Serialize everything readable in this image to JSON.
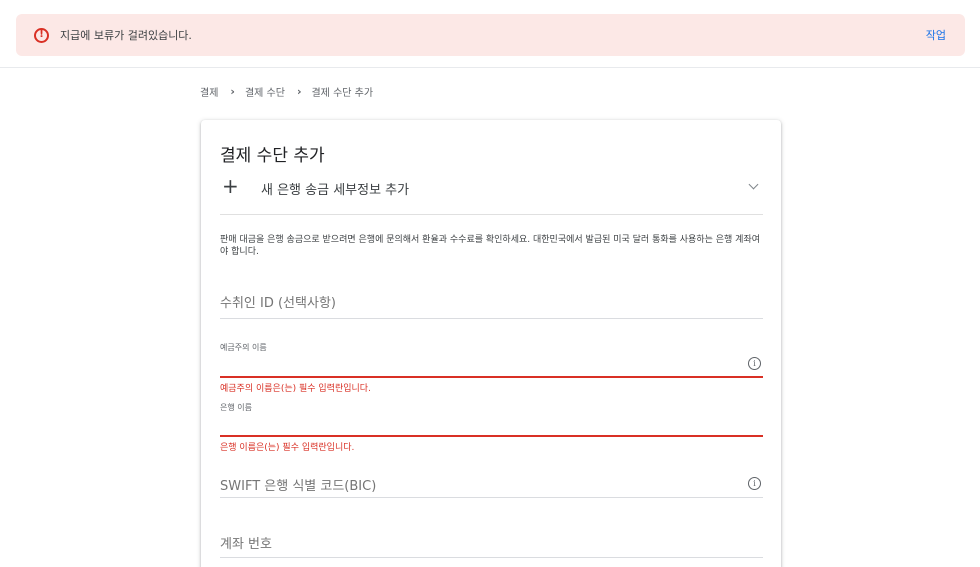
{
  "alert": {
    "icon": "error-circle-icon",
    "message": "지급에 보류가 걸려있습니다.",
    "action_label": "작업",
    "colors": {
      "background": "#fce8e6",
      "icon": "#d93025",
      "action": "#1a73e8"
    }
  },
  "breadcrumb": [
    "결제",
    "결제 수단",
    "결제 수단 추가"
  ],
  "card": {
    "title": "결제 수단 추가",
    "add_section": {
      "icon": "plus-icon",
      "label": "새 은행 송금 세부정보 추가",
      "toggle_icon": "chevron-down-icon"
    },
    "info_text": "판매 대금을 은행 송금으로 받으려면 은행에 문의해서 환율과 수수료를 확인하세요. 대한민국에서 발급된 미국 달러 통화를 사용하는 은행 계좌여야 합니다.",
    "fields": {
      "recipient_id": {
        "placeholder": "수취인 ID (선택사항)"
      },
      "account_holder": {
        "label": "예금주의 이름",
        "value": "",
        "error": "예금주의 이름은(는) 필수 입력란입니다.",
        "icon": "info-icon"
      },
      "bank_name": {
        "label": "은행 이름",
        "value": "",
        "error": "은행 이름은(는) 필수 입력란입니다."
      },
      "swift": {
        "placeholder": "SWIFT 은행 식별 코드(BIC)",
        "icon": "info-icon"
      },
      "account_number": {
        "placeholder": "계좌 번호"
      }
    },
    "error_color": "#d93025"
  }
}
